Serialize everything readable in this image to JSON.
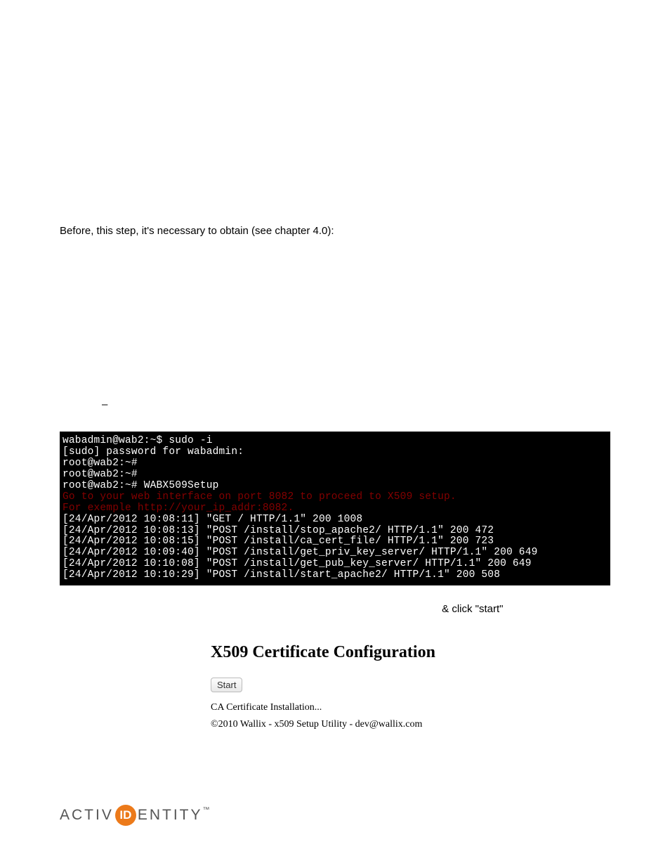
{
  "intro": "Before, this step, it's necessary to obtain (see chapter 4.0):",
  "dash": "–",
  "terminal": {
    "lines": [
      {
        "t": "wabadmin@wab2:~$ sudo -i",
        "c": "w"
      },
      {
        "t": "[sudo] password for wabadmin:",
        "c": "w"
      },
      {
        "t": "root@wab2:~#",
        "c": "w"
      },
      {
        "t": "root@wab2:~#",
        "c": "w"
      },
      {
        "t": "root@wab2:~# WABX509Setup",
        "c": "w"
      },
      {
        "t": "Go to your web interface on port 8082 to proceed to X509 setup.",
        "c": "r"
      },
      {
        "t": "For exemple http://your_ip_addr:8082.",
        "c": "r"
      },
      {
        "t": "[24/Apr/2012 10:08:11] \"GET / HTTP/1.1\" 200 1008",
        "c": "w"
      },
      {
        "t": "[24/Apr/2012 10:08:13] \"POST /install/stop_apache2/ HTTP/1.1\" 200 472",
        "c": "w"
      },
      {
        "t": "[24/Apr/2012 10:08:15] \"POST /install/ca_cert_file/ HTTP/1.1\" 200 723",
        "c": "w"
      },
      {
        "t": "[24/Apr/2012 10:09:40] \"POST /install/get_priv_key_server/ HTTP/1.1\" 200 649",
        "c": "w"
      },
      {
        "t": "[24/Apr/2012 10:10:08] \"POST /install/get_pub_key_server/ HTTP/1.1\" 200 649",
        "c": "w"
      },
      {
        "t": "[24/Apr/2012 10:10:29] \"POST /install/start_apache2/ HTTP/1.1\" 200 508",
        "c": "w"
      }
    ]
  },
  "url_row": {
    "link": " ",
    "after": " & click \"start\""
  },
  "config": {
    "title": "X509 Certificate Configuration",
    "button": "Start",
    "line1": "CA Certificate Installation...",
    "line2": "©2010 Wallix - x509 Setup Utility - dev@wallix.com"
  },
  "logo": {
    "left": "ACTIV",
    "id": "ID",
    "right": "ENTITY",
    "tm": "™"
  }
}
